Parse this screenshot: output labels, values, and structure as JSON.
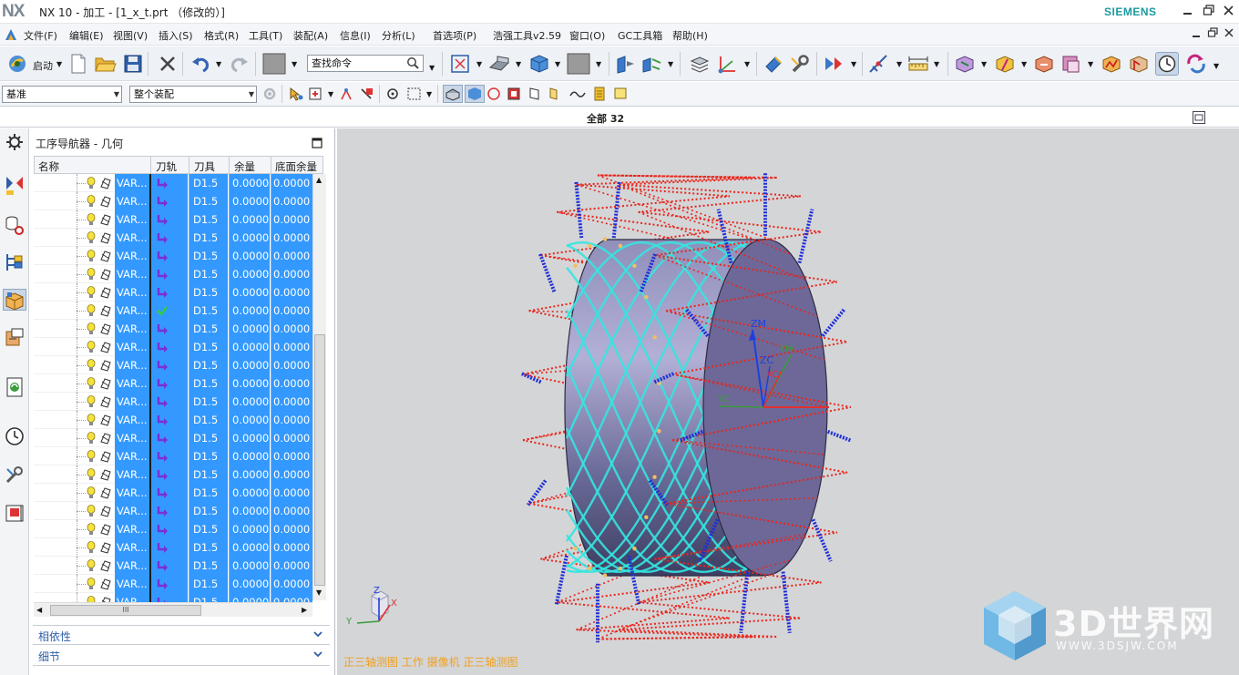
{
  "titlebar": {
    "logo": "NX",
    "title": "NX 10 - 加工 - [1_x_t.prt （修改的）]",
    "brand": "SIEMENS",
    "controls": [
      "minimize-icon",
      "restore-icon",
      "close-icon"
    ]
  },
  "menubar": {
    "items": [
      "文件(F)",
      "编辑(E)",
      "视图(V)",
      "插入(S)",
      "格式(R)",
      "工具(T)",
      "装配(A)",
      "信息(I)",
      "分析(L)",
      "首选项(P)",
      "浩强工具v2.59",
      "窗口(O)",
      "GC工具箱",
      "帮助(H)"
    ],
    "doc_controls": [
      "minimize-icon",
      "restore-icon",
      "close-icon"
    ]
  },
  "toolbar1": {
    "start_label": "启动",
    "search_placeholder": "查找命令"
  },
  "toolbar2": {
    "filter_value": "基准",
    "assembly_value": "整个装配"
  },
  "view_header": {
    "label": "全部 32"
  },
  "navigator": {
    "title": "工序导航器 - 几何",
    "columns": [
      "名称",
      "刀轨",
      "刀具",
      "余量",
      "底面余量"
    ],
    "rows": [
      {
        "name": "VAR...",
        "path": "arrow",
        "tool": "D1.5",
        "stock": "0.0000",
        "floor": "0.0000"
      },
      {
        "name": "VAR...",
        "path": "arrow",
        "tool": "D1.5",
        "stock": "0.0000",
        "floor": "0.0000"
      },
      {
        "name": "VAR...",
        "path": "arrow",
        "tool": "D1.5",
        "stock": "0.0000",
        "floor": "0.0000"
      },
      {
        "name": "VAR...",
        "path": "arrow",
        "tool": "D1.5",
        "stock": "0.0000",
        "floor": "0.0000"
      },
      {
        "name": "VAR...",
        "path": "arrow",
        "tool": "D1.5",
        "stock": "0.0000",
        "floor": "0.0000"
      },
      {
        "name": "VAR...",
        "path": "arrow",
        "tool": "D1.5",
        "stock": "0.0000",
        "floor": "0.0000"
      },
      {
        "name": "VAR...",
        "path": "arrow",
        "tool": "D1.5",
        "stock": "0.0000",
        "floor": "0.0000"
      },
      {
        "name": "VAR...",
        "path": "check",
        "tool": "D1.5",
        "stock": "0.0000",
        "floor": "0.0000"
      },
      {
        "name": "VAR...",
        "path": "arrow",
        "tool": "D1.5",
        "stock": "0.0000",
        "floor": "0.0000"
      },
      {
        "name": "VAR...",
        "path": "arrow",
        "tool": "D1.5",
        "stock": "0.0000",
        "floor": "0.0000"
      },
      {
        "name": "VAR...",
        "path": "arrow",
        "tool": "D1.5",
        "stock": "0.0000",
        "floor": "0.0000"
      },
      {
        "name": "VAR...",
        "path": "arrow",
        "tool": "D1.5",
        "stock": "0.0000",
        "floor": "0.0000"
      },
      {
        "name": "VAR...",
        "path": "arrow",
        "tool": "D1.5",
        "stock": "0.0000",
        "floor": "0.0000"
      },
      {
        "name": "VAR...",
        "path": "arrow",
        "tool": "D1.5",
        "stock": "0.0000",
        "floor": "0.0000"
      },
      {
        "name": "VAR...",
        "path": "arrow",
        "tool": "D1.5",
        "stock": "0.0000",
        "floor": "0.0000"
      },
      {
        "name": "VAR...",
        "path": "arrow",
        "tool": "D1.5",
        "stock": "0.0000",
        "floor": "0.0000"
      },
      {
        "name": "VAR...",
        "path": "arrow",
        "tool": "D1.5",
        "stock": "0.0000",
        "floor": "0.0000"
      },
      {
        "name": "VAR...",
        "path": "arrow",
        "tool": "D1.5",
        "stock": "0.0000",
        "floor": "0.0000"
      },
      {
        "name": "VAR...",
        "path": "arrow",
        "tool": "D1.5",
        "stock": "0.0000",
        "floor": "0.0000"
      },
      {
        "name": "VAR...",
        "path": "arrow",
        "tool": "D1.5",
        "stock": "0.0000",
        "floor": "0.0000"
      },
      {
        "name": "VAR...",
        "path": "arrow",
        "tool": "D1.5",
        "stock": "0.0000",
        "floor": "0.0000"
      },
      {
        "name": "VAR...",
        "path": "arrow",
        "tool": "D1.5",
        "stock": "0.0000",
        "floor": "0.0000"
      },
      {
        "name": "VAR...",
        "path": "arrow",
        "tool": "D1.5",
        "stock": "0.0000",
        "floor": "0.0000"
      },
      {
        "name": "VAR...",
        "path": "arrow",
        "tool": "D1.5",
        "stock": "0.0000",
        "floor": "0.0000"
      }
    ],
    "hscroll_label": "III",
    "sections": [
      "相依性",
      "细节"
    ]
  },
  "viewport": {
    "axes": {
      "zm": "ZM",
      "zc": "ZC",
      "ym": "YM",
      "xc": "XC",
      "yc": "YC"
    },
    "triad": {
      "z": "Z",
      "y": "Y",
      "x": "X"
    },
    "status": "正三轴测图 工作 摄像机 正三轴测图",
    "watermark_main": "3D世界网",
    "watermark_sub": "WWW.3DSJW.COM"
  },
  "colors": {
    "selection": "#3399ff",
    "toolpath_red": "#e8261c",
    "toolpath_blue": "#1f2fd6",
    "toolpath_cyan": "#34e6e0",
    "cylinder": "#6e6ea0",
    "viewport_bg": "#d4d5d7",
    "status_text": "#f0a020"
  }
}
